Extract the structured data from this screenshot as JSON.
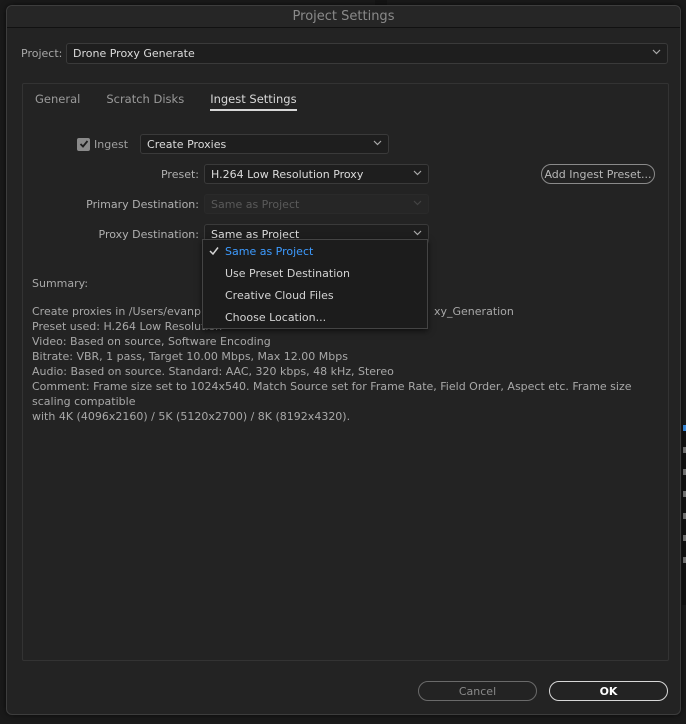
{
  "dialog": {
    "title": "Project Settings",
    "project_label": "Project:",
    "project_value": "Drone Proxy Generate"
  },
  "tabs": [
    {
      "label": "General",
      "active": false
    },
    {
      "label": "Scratch Disks",
      "active": false
    },
    {
      "label": "Ingest Settings",
      "active": true
    }
  ],
  "ingest": {
    "checkbox_label": "Ingest",
    "checked": true,
    "mode_value": "Create Proxies",
    "preset_label": "Preset:",
    "preset_value": "H.264 Low Resolution Proxy",
    "add_preset_button": "Add Ingest Preset...",
    "primary_destination_label": "Primary Destination:",
    "primary_destination_value": "Same as Project",
    "proxy_destination_label": "Proxy Destination:",
    "proxy_destination_value": "Same as Project"
  },
  "dropdown": {
    "items": [
      {
        "label": "Same as Project",
        "selected": true
      },
      {
        "label": "Use Preset Destination",
        "selected": false
      },
      {
        "label": "Creative Cloud Files",
        "selected": false
      },
      {
        "label": "Choose Location...",
        "selected": false
      }
    ]
  },
  "summary": {
    "title": "Summary:",
    "lines": [
      "Create proxies in /Users/evanplett/",
      "Preset used: H.264 Low Resolution",
      "Video: Based on source, Software Encoding",
      "Bitrate: VBR, 1 pass, Target 10.00 Mbps, Max 12.00 Mbps",
      "Audio: Based on source. Standard: AAC, 320 kbps, 48 kHz, Stereo",
      "Comment: Frame size set to 1024x540. Match Source set for Frame Rate, Field Order, Aspect etc. Frame size scaling compatible",
      "with 4K (4096x2160) / 5K (5120x2700) / 8K (8192x4320)."
    ],
    "line0_tail": "xy_Generation"
  },
  "buttons": {
    "cancel": "Cancel",
    "ok": "OK"
  },
  "colors": {
    "accent": "#3d9bff",
    "background": "#232323"
  }
}
